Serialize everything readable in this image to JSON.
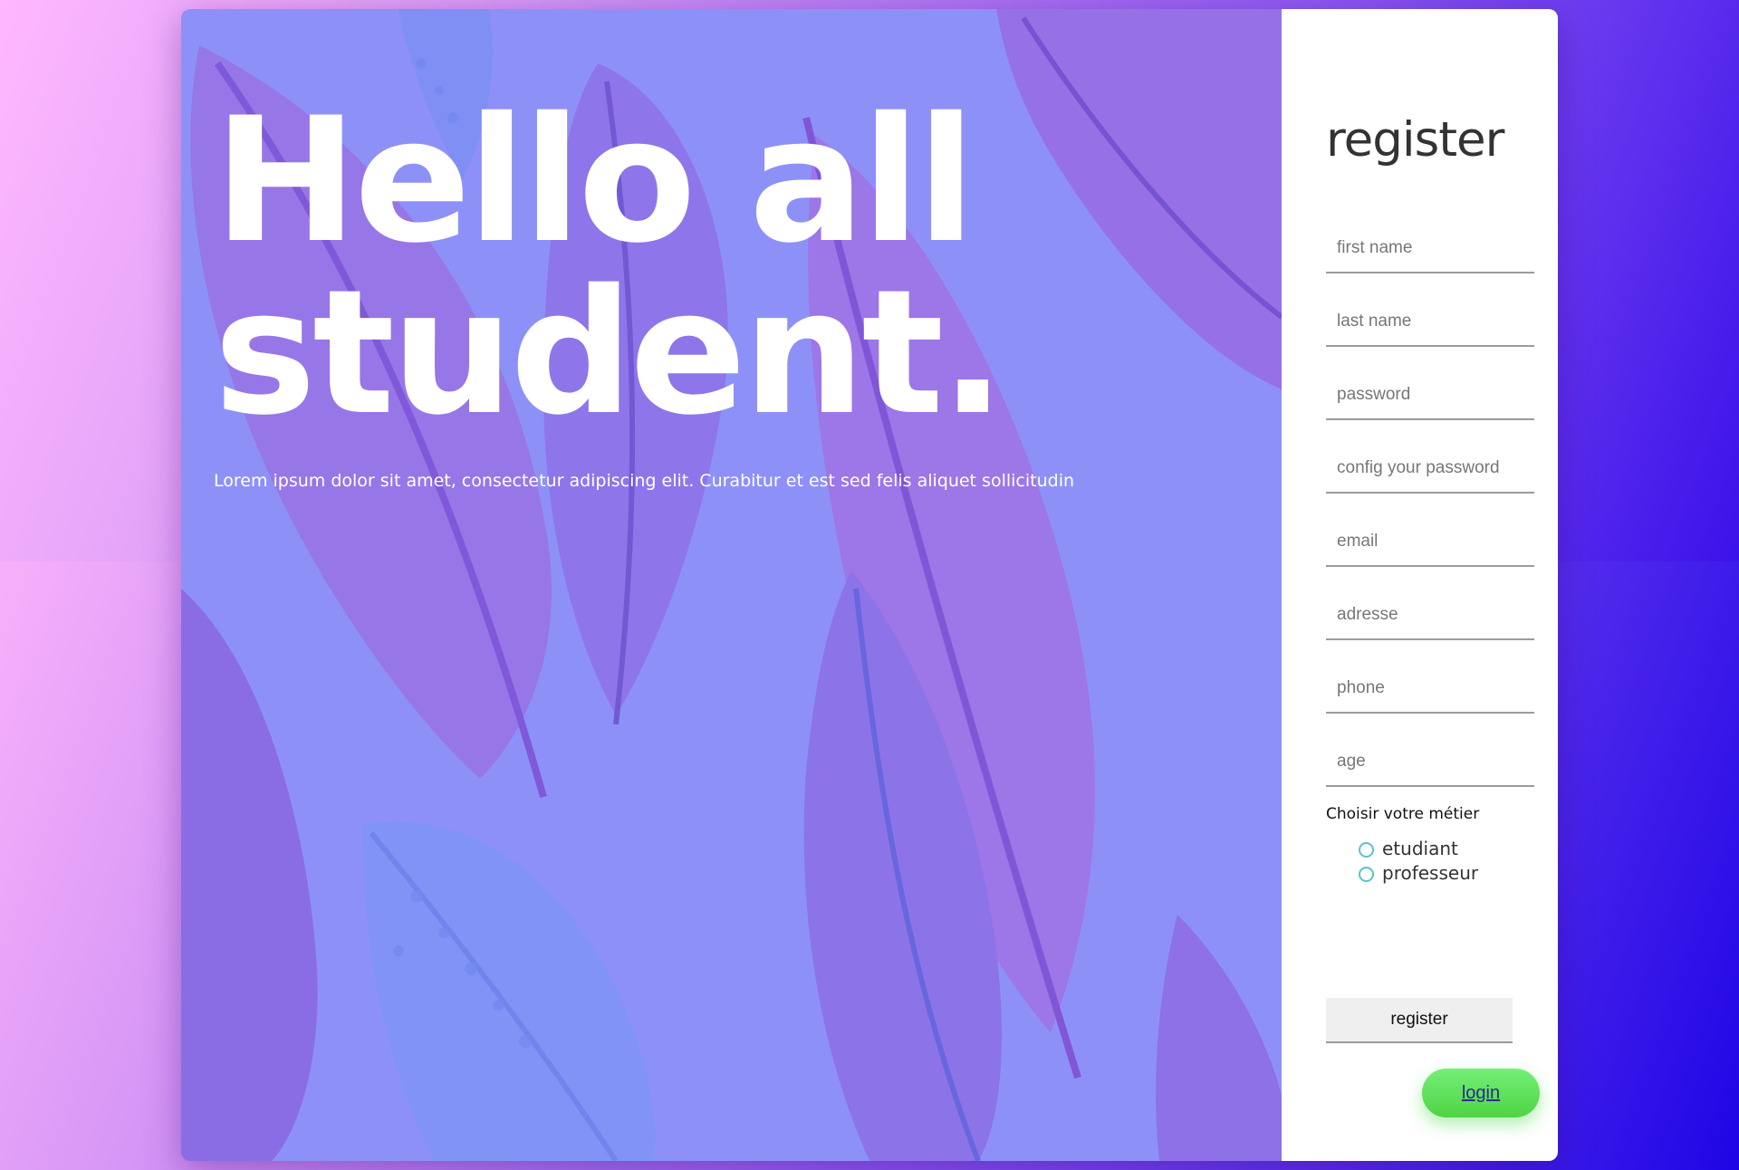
{
  "hero": {
    "headline_line1": "Hello all",
    "headline_line2": "student.",
    "subtitle": "Lorem ipsum dolor sit amet, consectetur adipiscing elit. Curabitur et est sed felis aliquet sollicitudin"
  },
  "form": {
    "title": "register",
    "fields": {
      "first_name": "first name",
      "last_name": "last name",
      "password": "password",
      "confirm_password": "config your password",
      "email": "email",
      "address": "adresse",
      "phone": "phone",
      "age": "age"
    },
    "job_label": "Choisir votre métier",
    "options": {
      "student": "etudiant",
      "teacher": "professeur"
    },
    "register_label": "register",
    "login_label": "login"
  },
  "colors": {
    "hero_overlay": "#8d91f7",
    "feather_purple": "#8a5fe0",
    "feather_blue": "#6f88f5",
    "login_green": "#5fdc57",
    "radio_border": "#5ac3c8"
  },
  "icons": {
    "background_art": "feathers-illustration"
  }
}
